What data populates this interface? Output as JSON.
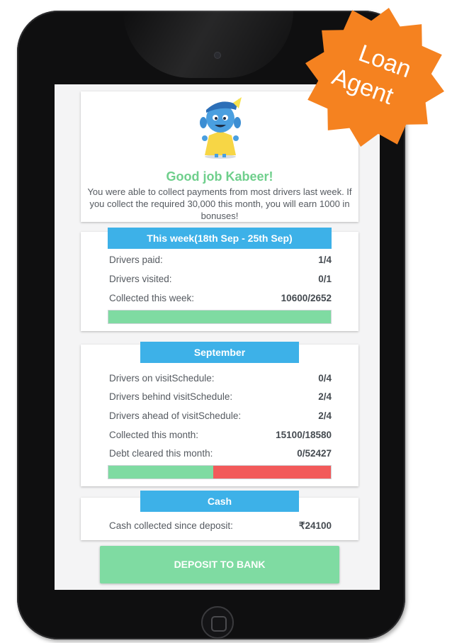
{
  "badge": {
    "line1": "Loan",
    "line2": "Agent"
  },
  "header": {
    "greeting": "Good job Kabeer!",
    "message": "You were able to collect payments from most drivers last week. If you collect the required 30,000 this month, you will earn 1000 in bonuses!",
    "mascot_icon": "happy-mascot-icon"
  },
  "week": {
    "title": "This week(18th Sep - 25th Sep)",
    "rows": [
      {
        "label": "Drivers paid:",
        "value": "1/4"
      },
      {
        "label": "Drivers visited:",
        "value": "0/1"
      },
      {
        "label": "Collected this week:",
        "value": "10600/2652"
      }
    ],
    "progress": 1.0
  },
  "month": {
    "title": "September",
    "rows": [
      {
        "label": "Drivers on visitSchedule:",
        "value": "0/4"
      },
      {
        "label": "Drivers behind visitSchedule:",
        "value": "2/4"
      },
      {
        "label": "Drivers ahead of visitSchedule:",
        "value": "2/4"
      },
      {
        "label": "Collected this month:",
        "value": "15100/18580"
      },
      {
        "label": "Debt cleared this month:",
        "value": "0/52427"
      }
    ],
    "progress": 0.47
  },
  "cash": {
    "title": "Cash",
    "rows": [
      {
        "label": "Cash collected since deposit:",
        "value": "₹24100"
      }
    ]
  },
  "deposit_button": "DEPOSIT TO BANK",
  "colors": {
    "accent_blue": "#3db1e8",
    "success_green": "#7fdba2",
    "danger_red": "#f25a5a",
    "badge_orange": "#f58220",
    "greeting_green": "#6fcf8c"
  }
}
